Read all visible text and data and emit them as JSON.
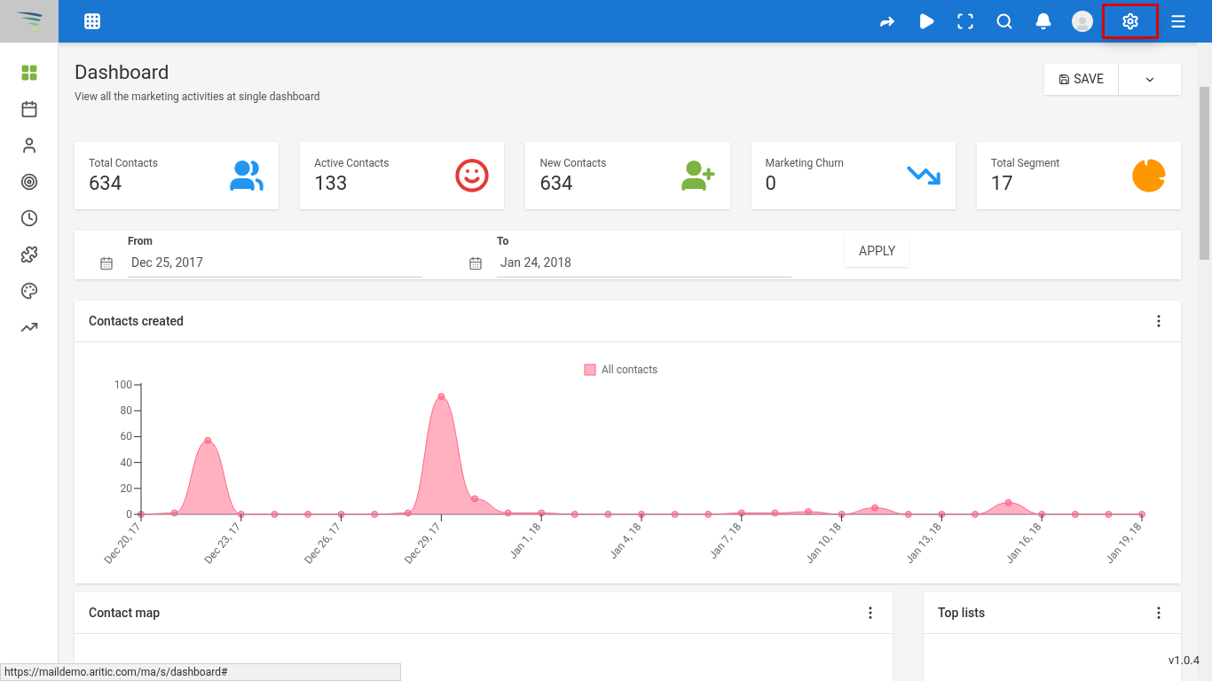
{
  "topbar": {
    "icons": [
      {
        "kind": "share",
        "highlighted": false
      },
      {
        "kind": "play",
        "highlighted": false
      },
      {
        "kind": "fullscreen",
        "highlighted": false
      },
      {
        "kind": "search",
        "highlighted": false
      },
      {
        "kind": "bell",
        "highlighted": false
      },
      {
        "kind": "avatar",
        "highlighted": false
      },
      {
        "kind": "settings",
        "highlighted": true
      },
      {
        "kind": "menu",
        "highlighted": false
      }
    ]
  },
  "sidebar": {
    "items": [
      {
        "kind": "dashboard",
        "selected": true
      },
      {
        "kind": "calendar",
        "selected": false
      },
      {
        "kind": "user",
        "selected": false
      },
      {
        "kind": "target",
        "selected": false
      },
      {
        "kind": "clock",
        "selected": false
      },
      {
        "kind": "puzzle",
        "selected": false
      },
      {
        "kind": "palette",
        "selected": false
      },
      {
        "kind": "chart",
        "selected": false
      }
    ]
  },
  "header": {
    "title": "Dashboard",
    "subtitle": "View all the marketing activities at single dashboard",
    "save_button": "SAVE"
  },
  "stats": [
    {
      "label": "Total Contacts",
      "value": "634",
      "kind": "users",
      "color": "#2196f3"
    },
    {
      "label": "Active Contacts",
      "value": "133",
      "kind": "face",
      "color": "#e53935"
    },
    {
      "label": "New Contacts",
      "value": "634",
      "kind": "user-plus",
      "color": "#7cb342"
    },
    {
      "label": "Marketing Churn",
      "value": "0",
      "kind": "trend-down",
      "color": "#2196f3"
    },
    {
      "label": "Total Segment",
      "value": "17",
      "kind": "pie",
      "color": "#ff9800"
    }
  ],
  "date_filter": {
    "from": {
      "label": "From",
      "value": "Dec 25, 2017"
    },
    "to": {
      "label": "To",
      "value": "Jan 24, 2018"
    },
    "apply_button": "APPLY"
  },
  "contacts_chart": {
    "title": "Contacts created",
    "chart_data": {
      "type": "area",
      "categories": [
        "Dec 20, 17",
        null,
        null,
        "Dec 23, 17",
        null,
        null,
        "Dec 26, 17",
        null,
        null,
        "Dec 29, 17",
        null,
        null,
        "Jan 1, 18",
        null,
        null,
        "Jan 4, 18",
        null,
        null,
        "Jan 7, 18",
        null,
        null,
        "Jan 10, 18",
        null,
        null,
        "Jan 13, 18",
        null,
        null,
        "Jan 16, 18",
        null,
        null,
        "Jan 19, 18"
      ],
      "series": [
        {
          "name": "All contacts",
          "color": "#ff6384",
          "values": [
            0,
            1,
            57,
            0,
            0,
            0,
            0,
            0,
            1,
            91,
            12,
            1,
            1,
            0,
            0,
            0,
            0,
            0,
            1,
            1,
            2,
            0,
            5,
            0,
            0,
            0,
            9,
            0,
            0,
            0,
            0
          ]
        }
      ],
      "ylim": [
        0,
        100
      ],
      "yticks": [
        0,
        20,
        40,
        60,
        80,
        100
      ]
    }
  },
  "bottom_cards": [
    {
      "title": "Contact map"
    },
    {
      "title": "Top lists"
    }
  ],
  "status_url": "https://maildemo.aritic.com/ma/s/dashboard#",
  "version": "v1.0.4"
}
